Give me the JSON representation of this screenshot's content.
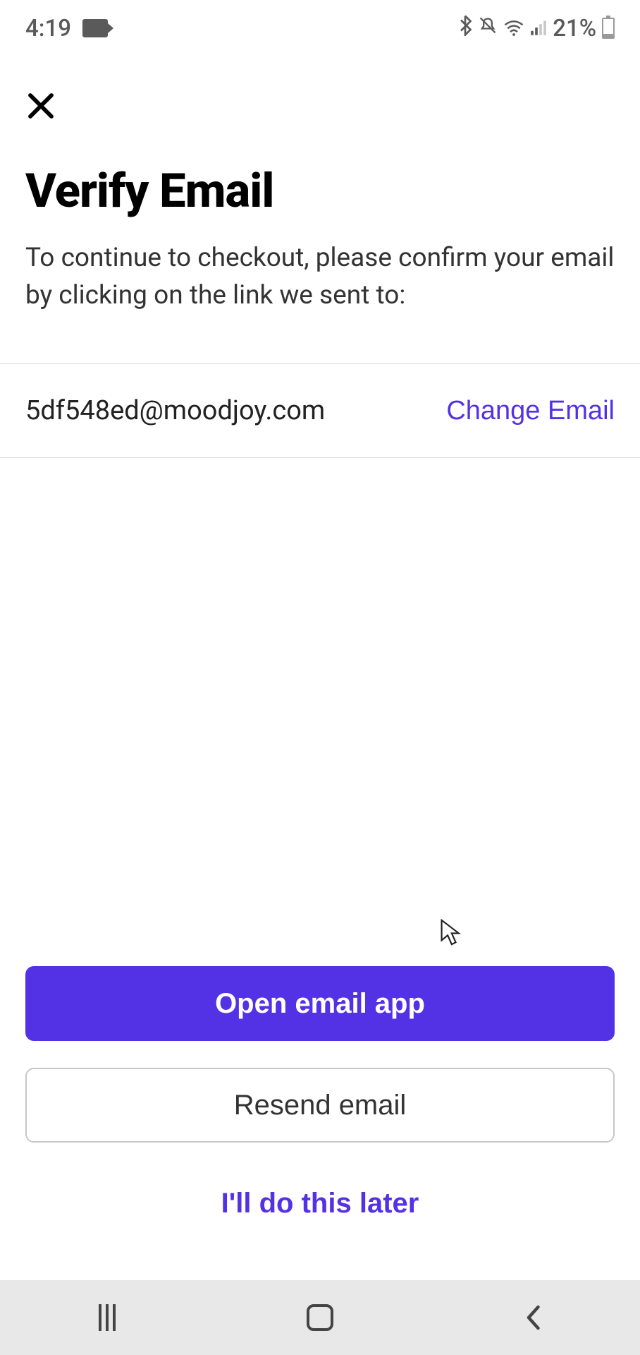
{
  "status": {
    "time": "4:19",
    "battery_text": "21%"
  },
  "page": {
    "title": "Verify Email",
    "subtitle": "To continue to checkout, please confirm your email by clicking on the link we sent to:"
  },
  "email": {
    "value": "5df548ed@moodjoy.com",
    "change_label": "Change Email"
  },
  "buttons": {
    "primary": "Open email app",
    "secondary": "Resend email",
    "tertiary": "I'll do this later"
  },
  "colors": {
    "accent": "#5332E6"
  }
}
